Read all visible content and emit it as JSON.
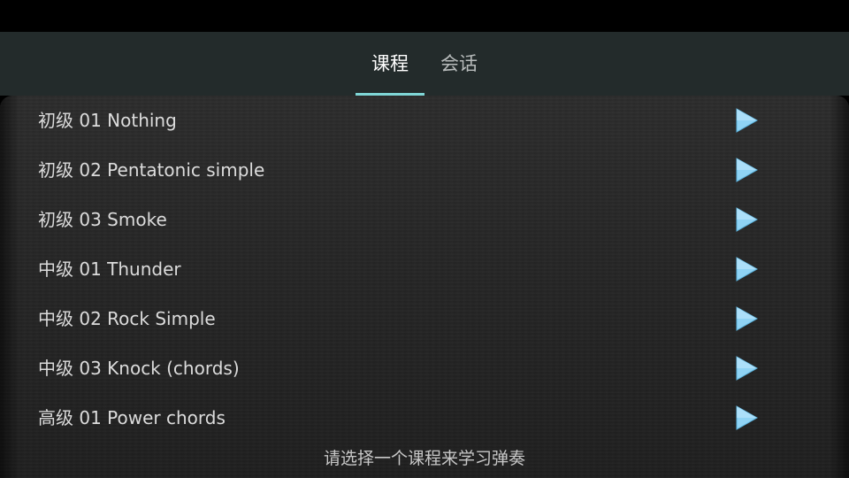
{
  "tabs": [
    {
      "label": "课程",
      "active": true
    },
    {
      "label": "会话",
      "active": false
    }
  ],
  "courses": [
    {
      "label": "初级 01 Nothing",
      "icon": "play-icon"
    },
    {
      "label": "初级 02 Pentatonic simple",
      "icon": "play-icon"
    },
    {
      "label": "初级 03 Smoke",
      "icon": "play-icon"
    },
    {
      "label": "中级 01 Thunder",
      "icon": "play-icon"
    },
    {
      "label": "中级 02 Rock Simple",
      "icon": "play-icon"
    },
    {
      "label": "中级 03 Knock (chords)",
      "icon": "play-icon"
    },
    {
      "label": "高级 01 Power chords",
      "icon": "play-icon"
    }
  ],
  "hint": "请选择一个课程来学习弹奏",
  "colors": {
    "header_bg": "#232b2b",
    "tab_underline": "#7fd6d6",
    "play_icon": "#8fd3f4"
  }
}
